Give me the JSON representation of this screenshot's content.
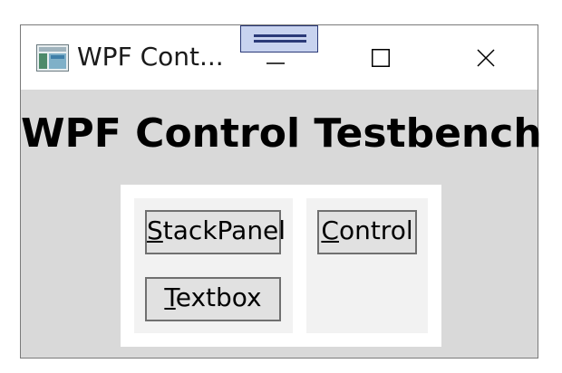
{
  "window": {
    "title": "WPF Cont...",
    "minimize_label": "Minimize",
    "maximize_label": "Maximize",
    "close_label": "Close"
  },
  "main": {
    "heading": "WPF Control Testbench",
    "buttons": {
      "stackpanel": {
        "access_key": "S",
        "rest": "tackPanel"
      },
      "textbox": {
        "access_key": "T",
        "rest": "extbox"
      },
      "control": {
        "access_key": "C",
        "rest": "ontrol"
      }
    }
  },
  "colors": {
    "client_background": "#d9d9d9",
    "button_face": "#e1e1e1",
    "button_border": "#707070",
    "panel_background": "#f2f2f2",
    "grip_fill": "#c8d3ef",
    "grip_border": "#2b3a78"
  },
  "icons": [
    "wpf-app-icon",
    "drag-grip-icon",
    "minimize-icon",
    "maximize-icon",
    "close-icon"
  ]
}
